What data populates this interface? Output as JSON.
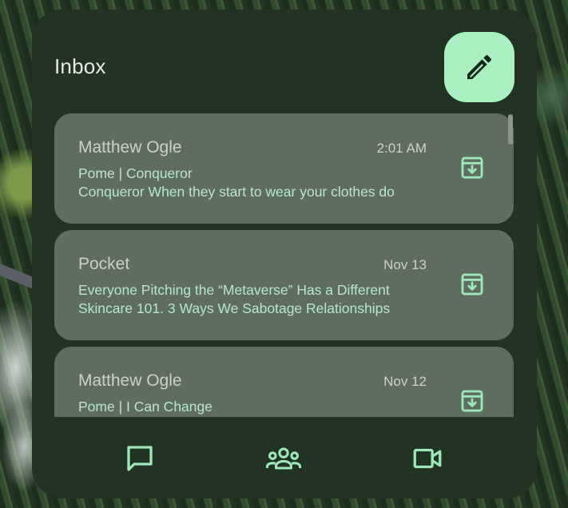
{
  "widget": {
    "title": "Inbox",
    "compose_icon": "pencil-icon"
  },
  "messages": [
    {
      "sender": "Matthew Ogle",
      "time": "2:01 AM",
      "line1": "Pome | Conqueror",
      "line2": "Conqueror When they start to wear your clothes do",
      "action_icon": "archive-icon"
    },
    {
      "sender": "Pocket",
      "time": "Nov 13",
      "line1": "Everyone Pitching the “Metaverse” Has a Different",
      "line2": "Skincare 101. 3 Ways We Sabotage Relationships",
      "action_icon": "archive-icon"
    },
    {
      "sender": "Matthew Ogle",
      "time": "Nov 12",
      "line1": "Pome | I Can Change",
      "line2": "",
      "action_icon": "archive-icon"
    }
  ],
  "bottom_nav": [
    {
      "icon": "chat-icon"
    },
    {
      "icon": "groups-icon"
    },
    {
      "icon": "video-call-icon"
    }
  ],
  "colors": {
    "widget_bg": "#223223",
    "card_bg": "#5e6d5f",
    "accent": "#aaf0c2",
    "icon_tint": "#9ee7b7",
    "text_primary": "#c9d2c8"
  }
}
